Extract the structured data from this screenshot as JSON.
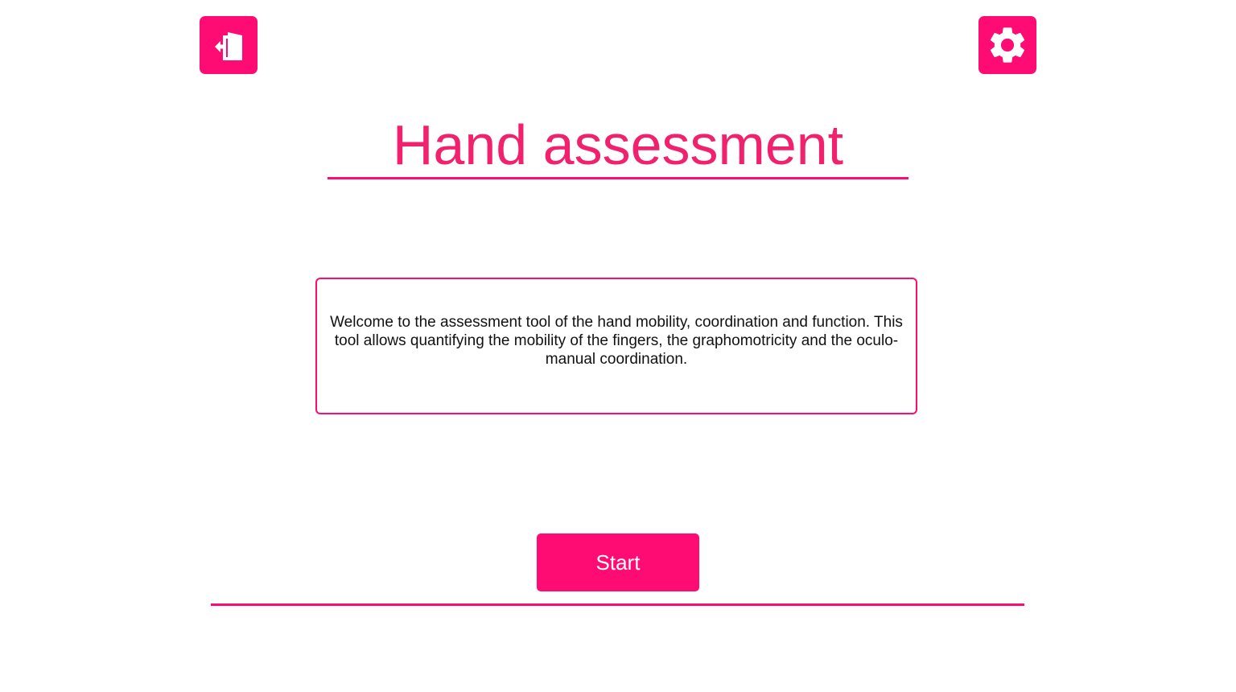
{
  "colors": {
    "accent": "#ff0b74",
    "title": "#f2216e",
    "text": "#111111",
    "background": "#ffffff"
  },
  "header": {
    "exit_icon": "exit-door-icon",
    "settings_icon": "gear-icon"
  },
  "main": {
    "title": "Hand assessment",
    "welcome_text": "Welcome to the assessment tool of the hand mobility, coordination and function. This tool allows quantifying the mobility of the fingers, the graphomotricity and the oculo-manual coordination.",
    "start_label": "Start"
  }
}
